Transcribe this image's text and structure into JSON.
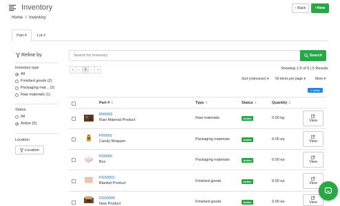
{
  "app": {
    "title": "Inventory",
    "back_label": "‹ Back",
    "new_label": "New"
  },
  "breadcrumb": {
    "home": "Home",
    "sep": "/",
    "current": "Inventory"
  },
  "tabs": [
    "Part #",
    "Lot #"
  ],
  "sidebar": {
    "refine": "Refine by",
    "inventory_type_label": "Inventory type",
    "inventory_types": [
      {
        "label": "All",
        "checked": true
      },
      {
        "label": "Finished goods (2)",
        "checked": false
      },
      {
        "label": "Packaging mat... (2)",
        "checked": false
      },
      {
        "label": "Raw materials (1)",
        "checked": false
      }
    ],
    "status_label": "Status",
    "statuses": [
      {
        "label": "All",
        "checked": false
      },
      {
        "label": "Active (5)",
        "checked": true
      }
    ],
    "location_label": "Location",
    "location_button": "Location"
  },
  "search": {
    "placeholder": "Search for Inventory",
    "button": "Search"
  },
  "pager": {
    "first": "«",
    "prev": "‹",
    "page": "1",
    "next": "›",
    "last": "»"
  },
  "results_text": "Showing 1-5 of 5 | 5 Results",
  "sort": {
    "sort_label": "Sort (relevance)",
    "per_page": "50 items per page",
    "more": "More"
  },
  "active_filter": "× active",
  "table": {
    "headers": {
      "part": "Part #",
      "type": "Type",
      "status": "Status",
      "quantity": "Quantity"
    },
    "rows": [
      {
        "part_no": "R00000",
        "name": "Raw Material Product",
        "type": "Raw materials",
        "status": "Active",
        "qty": "0.00 kg",
        "view": "View"
      },
      {
        "part_no": "P00001",
        "name": "Candy Wrapper",
        "type": "Packaging materials",
        "status": "Active",
        "qty": "0.00 ea",
        "view": "View"
      },
      {
        "part_no": "P00000",
        "name": "Box",
        "type": "Packaging materials",
        "status": "Active",
        "qty": "0.00 ea",
        "view": "View"
      },
      {
        "part_no": "FG00001",
        "name": "Blanket Product",
        "type": "Finished goods",
        "status": "Active",
        "qty": "0.00 ea",
        "view": "View"
      },
      {
        "part_no": "FG00000",
        "name": "New Product",
        "type": "Finished goods",
        "status": "Active",
        "qty": "0.00 ea",
        "view": "View"
      }
    ]
  },
  "colors": {
    "accent": "#28a745",
    "link": "#1a6fb5",
    "filter_badge": "#1e88e5"
  }
}
